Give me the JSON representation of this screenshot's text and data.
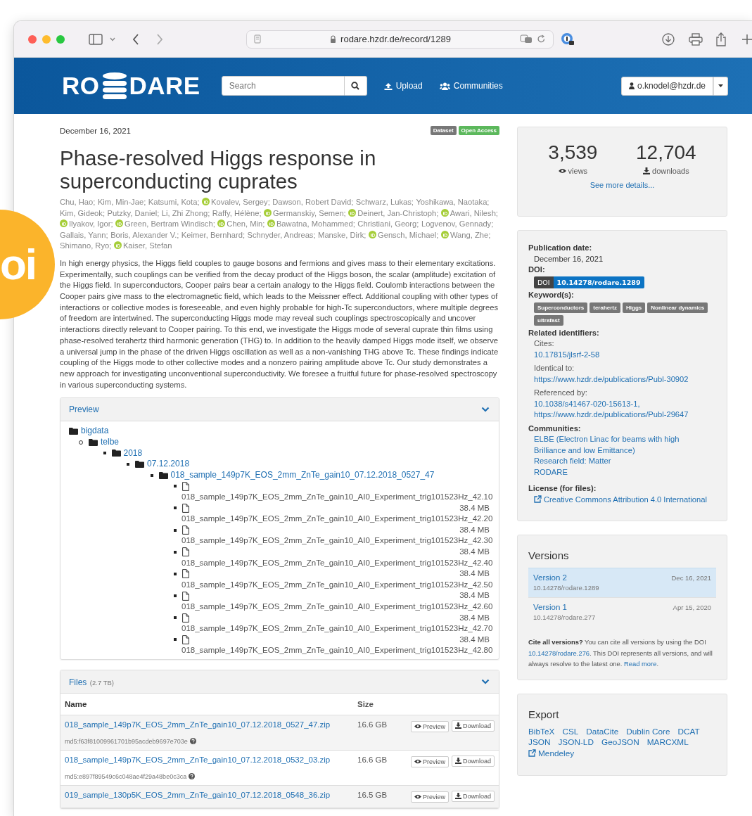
{
  "overlay_badge": {
    "text": "oi"
  },
  "browser": {
    "url": "rodare.hzdr.de/record/1289"
  },
  "header": {
    "logo_left": "RO",
    "logo_right": "DARE",
    "search": {
      "placeholder": "Search"
    },
    "nav": [
      {
        "kind": "upload",
        "label": "Upload"
      },
      {
        "kind": "communities",
        "label": "Communities"
      }
    ],
    "user": "o.knodel@hzdr.de"
  },
  "record": {
    "date": "December 16, 2021",
    "badges": [
      {
        "label": "Dataset",
        "color": "#777777"
      },
      {
        "label": "Open Access",
        "color": "#5cb85c"
      }
    ],
    "title": "Phase-resolved Higgs response in superconducting cuprates",
    "authors": [
      {
        "name": "Chu, Hao;",
        "orcid": false
      },
      {
        "name": "Kim, Min-Jae;",
        "orcid": false
      },
      {
        "name": "Katsumi, Kota;",
        "orcid": false
      },
      {
        "name": "Kovalev, Sergey;",
        "orcid": true
      },
      {
        "name": "Dawson, Robert David;",
        "orcid": false
      },
      {
        "name": "Schwarz, Lukas;",
        "orcid": false
      },
      {
        "name": "Yoshikawa, Naotaka;",
        "orcid": false
      },
      {
        "name": "Kim, Gideok;",
        "orcid": false
      },
      {
        "name": "Putzky, Daniel;",
        "orcid": false
      },
      {
        "name": "Li, Zhi Zhong;",
        "orcid": false
      },
      {
        "name": "Raffy, Hélène;",
        "orcid": false
      },
      {
        "name": "Germanskiy, Semen;",
        "orcid": true
      },
      {
        "name": "Deinert, Jan-Christoph;",
        "orcid": true
      },
      {
        "name": "Awari, Nilesh;",
        "orcid": true
      },
      {
        "name": "Ilyakov, Igor;",
        "orcid": true
      },
      {
        "name": "Green, Bertram Windisch;",
        "orcid": true
      },
      {
        "name": "Chen, Min;",
        "orcid": true
      },
      {
        "name": "Bawatna, Mohammed;",
        "orcid": true
      },
      {
        "name": "Christiani, Georg;",
        "orcid": false
      },
      {
        "name": "Logvenov, Gennady;",
        "orcid": false
      },
      {
        "name": "Gallais, Yann;",
        "orcid": false
      },
      {
        "name": "Boris, Alexander V.;",
        "orcid": false
      },
      {
        "name": "Keimer, Bernhard;",
        "orcid": false
      },
      {
        "name": "Schnyder, Andreas;",
        "orcid": false
      },
      {
        "name": "Manske, Dirk;",
        "orcid": false
      },
      {
        "name": "Gensch, Michael;",
        "orcid": true
      },
      {
        "name": "Wang, Zhe;",
        "orcid": true
      },
      {
        "name": "Shimano, Ryo;",
        "orcid": false
      },
      {
        "name": "Kaiser, Stefan",
        "orcid": true
      }
    ],
    "abstract": "In high energy physics, the Higgs field couples to gauge bosons and fermions and gives mass to their elementary excitations. Experimentally, such couplings can be verified from the decay product of the Higgs boson, the scalar (amplitude) excitation of the Higgs field. In superconductors, Cooper pairs bear a certain analogy to the Higgs field. Coulomb interactions between the Cooper pairs give mass to the electromagnetic field, which leads to the Meissner effect. Additional coupling with other types of interactions or collective modes is foreseeable, and even highly probable for high-Tc superconductors, where multiple degrees of freedom are intertwined. The superconducting Higgs mode may reveal such couplings spectroscopically and uncover interactions directly relevant to Cooper pairing. To this end, we investigate the Higgs mode of several cuprate thin films using phase-resolved terahertz third harmonic generation (THG) to. In addition to the heavily damped Higgs mode itself, we observe a universal jump in the phase of the driven Higgs oscillation as well as a non-vanishing THG above Tc. These findings indicate coupling of the Higgs mode to other collective modes and a nonzero pairing amplitude above Tc. Our study demonstrates a new approach for investigating unconventional superconductivity. We foresee a fruitful future for phase-resolved spectroscopy in various superconducting systems."
  },
  "preview": {
    "title": "Preview",
    "expanded": true,
    "tree": [
      {
        "kind": "folder",
        "name": "bigdata",
        "children": [
          {
            "kind": "folder",
            "name": "telbe",
            "children": [
              {
                "kind": "folder",
                "name": "2018",
                "children": [
                  {
                    "kind": "folder",
                    "name": "07.12.2018",
                    "children": [
                      {
                        "kind": "folder",
                        "name": "018_sample_149p7K_EOS_2mm_ZnTe_gain10_07.12.2018_0527_47",
                        "children": [
                          {
                            "kind": "file",
                            "name": "018_sample_149p7K_EOS_2mm_ZnTe_gain10_AI0_Experiment_trig101523Hz_42.10",
                            "size": "38.4 MB"
                          },
                          {
                            "kind": "file",
                            "name": "018_sample_149p7K_EOS_2mm_ZnTe_gain10_AI0_Experiment_trig101523Hz_42.20",
                            "size": "38.4 MB"
                          },
                          {
                            "kind": "file",
                            "name": "018_sample_149p7K_EOS_2mm_ZnTe_gain10_AI0_Experiment_trig101523Hz_42.30",
                            "size": "38.4 MB"
                          },
                          {
                            "kind": "file",
                            "name": "018_sample_149p7K_EOS_2mm_ZnTe_gain10_AI0_Experiment_trig101523Hz_42.40",
                            "size": "38.4 MB"
                          },
                          {
                            "kind": "file",
                            "name": "018_sample_149p7K_EOS_2mm_ZnTe_gain10_AI0_Experiment_trig101523Hz_42.50",
                            "size": "38.4 MB"
                          },
                          {
                            "kind": "file",
                            "name": "018_sample_149p7K_EOS_2mm_ZnTe_gain10_AI0_Experiment_trig101523Hz_42.60",
                            "size": "38.4 MB"
                          },
                          {
                            "kind": "file",
                            "name": "018_sample_149p7K_EOS_2mm_ZnTe_gain10_AI0_Experiment_trig101523Hz_42.70",
                            "size": "38.4 MB"
                          },
                          {
                            "kind": "file",
                            "name": "018_sample_149p7K_EOS_2mm_ZnTe_gain10_AI0_Experiment_trig101523Hz_42.80"
                          }
                        ]
                      }
                    ]
                  }
                ]
              }
            ]
          }
        ]
      }
    ]
  },
  "files": {
    "title": "Files",
    "total": "(2.7 TB)",
    "expanded": true,
    "columns": [
      "Name",
      "Size"
    ],
    "rows": [
      {
        "name": "018_sample_149p7K_EOS_2mm_ZnTe_gain10_07.12.2018_0527_47.zip",
        "size": "16.6 GB",
        "md5": "md5:f63f81009961701b95acdeb9697e703e",
        "preview": "Preview",
        "download": "Download"
      },
      {
        "name": "018_sample_149p7K_EOS_2mm_ZnTe_gain10_07.12.2018_0532_03.zip",
        "size": "16.6 GB",
        "md5": "md5:e897f89549c6c048ae4f29a48be0c3ca",
        "preview": "Preview",
        "download": "Download"
      },
      {
        "name": "019_sample_130p5K_EOS_2mm_ZnTe_gain10_07.12.2018_0548_36.zip",
        "size": "16.5 GB",
        "preview": "Preview",
        "download": "Download"
      }
    ]
  },
  "stats": {
    "views": "3,539",
    "views_label": "views",
    "downloads": "12,704",
    "downloads_label": "downloads",
    "details_link": "See more details..."
  },
  "info": {
    "publication_date": {
      "label": "Publication date:",
      "value": "December 16, 2021"
    },
    "doi": {
      "label": "DOI:",
      "prefix": "DOI",
      "value": "10.14278/rodare.1289"
    },
    "keywords": {
      "label": "Keyword(s):",
      "items": [
        "Superconductors",
        "terahertz",
        "Higgs",
        "Nonlinear dynamics",
        "ultrafast"
      ]
    },
    "related": {
      "label": "Related identifiers:",
      "groups": [
        {
          "label": "Cites:",
          "links": [
            "10.17815/jlsrf-2-58"
          ]
        },
        {
          "label": "Identical to:",
          "links": [
            "https://www.hzdr.de/publications/Publ-30902"
          ]
        },
        {
          "label": "Referenced by:",
          "links": [
            "10.1038/s41467-020-15613-1,",
            "https://www.hzdr.de/publications/Publ-29647"
          ]
        }
      ]
    },
    "communities": {
      "label": "Communities:",
      "links": [
        "ELBE (Electron Linac for beams with high Brilliance and low Emittance)",
        "Research field: Matter",
        "RODARE"
      ]
    },
    "license": {
      "label": "License (for files):",
      "link": "Creative Commons Attribution 4.0 International"
    }
  },
  "versions": {
    "title": "Versions",
    "items": [
      {
        "label": "Version 2",
        "doi": "10.14278/rodare.1289",
        "date": "Dec 16, 2021",
        "selected": true
      },
      {
        "label": "Version 1",
        "doi": "10.14278/rodare.277",
        "date": "Apr 15, 2020",
        "selected": false
      }
    ],
    "cite": [
      {
        "kind": "bold",
        "text": "Cite all versions?"
      },
      {
        "kind": "text",
        "text": " You can cite all versions by using the DOI "
      },
      {
        "kind": "link",
        "text": "10.14278/rodare.276"
      },
      {
        "kind": "text",
        "text": ". This DOI represents all versions, and will always resolve to the latest one. "
      },
      {
        "kind": "link",
        "text": "Read more"
      },
      {
        "kind": "text",
        "text": "."
      }
    ]
  },
  "export": {
    "title": "Export",
    "rows": [
      [
        {
          "kind": "link",
          "label": "BibTeX"
        },
        {
          "kind": "link",
          "label": "CSL"
        },
        {
          "kind": "link",
          "label": "DataCite"
        },
        {
          "kind": "link",
          "label": "Dublin Core"
        },
        {
          "kind": "link",
          "label": "DCAT"
        }
      ],
      [
        {
          "kind": "link",
          "label": "JSON"
        },
        {
          "kind": "link",
          "label": "JSON-LD"
        },
        {
          "kind": "link",
          "label": "GeoJSON"
        },
        {
          "kind": "link",
          "label": "MARCXML"
        }
      ],
      [
        {
          "kind": "external",
          "label": "Mendeley"
        }
      ]
    ]
  }
}
